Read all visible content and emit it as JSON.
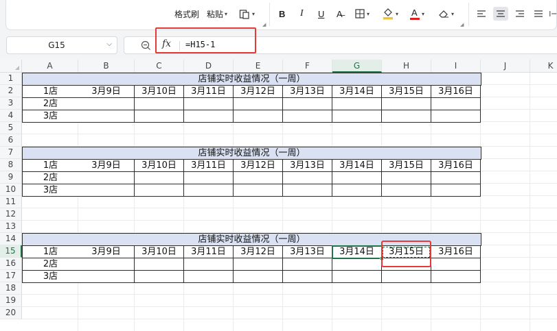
{
  "ribbon": {
    "format_painter": "格式刷",
    "paste": "粘贴",
    "paste_icon": "clipboard-icon",
    "bold": "B",
    "italic": "I",
    "underline": "U",
    "strikethrough": "A̶",
    "font_color_letter": "A",
    "fill_color": "#f4c430",
    "font_color": "#e02020"
  },
  "formula_bar": {
    "cell_ref": "G15",
    "fx_label": "fx",
    "formula": "=H15-1"
  },
  "columns": [
    "A",
    "B",
    "C",
    "D",
    "E",
    "F",
    "G",
    "H",
    "I",
    "J",
    "K"
  ],
  "rows": [
    "1",
    "2",
    "3",
    "4",
    "5",
    "6",
    "7",
    "8",
    "9",
    "10",
    "11",
    "12",
    "13",
    "14",
    "15",
    "16",
    "17",
    "18",
    "19",
    "20"
  ],
  "sheet": {
    "blocks": [
      {
        "title": "店铺实时收益情况（一周）",
        "header": [
          "1店",
          "3月9日",
          "3月10日",
          "3月11日",
          "3月12日",
          "3月13日",
          "3月14日",
          "3月15日",
          "3月16日"
        ],
        "stores": [
          "2店",
          "3店"
        ]
      },
      {
        "title": "店铺实时收益情况（一周）",
        "header": [
          "1店",
          "3月9日",
          "3月10日",
          "3月11日",
          "3月12日",
          "3月13日",
          "3月14日",
          "3月15日",
          "3月16日"
        ],
        "stores": [
          "2店",
          "3店"
        ]
      },
      {
        "title": "店铺实时收益情况（一周）",
        "header": [
          "1店",
          "3月9日",
          "3月10日",
          "3月11日",
          "3月12日",
          "3月13日",
          "3月14日",
          "3月15日",
          "3月16日"
        ],
        "stores": [
          "2店",
          "3店"
        ]
      }
    ]
  },
  "selection": {
    "active": "G15",
    "copied": "H15"
  },
  "colors": {
    "accent": "#217346",
    "highlight": "#e53935",
    "title_fill": "#d9e1f2"
  }
}
